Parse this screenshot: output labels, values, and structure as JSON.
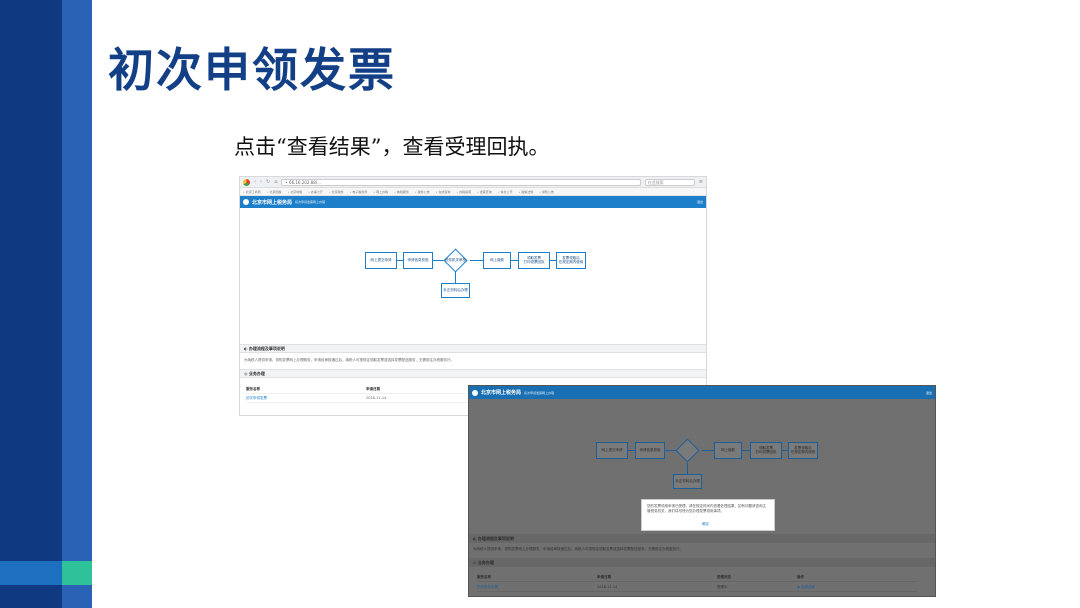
{
  "slide": {
    "title": "初次申领发票",
    "instruction": "点击“查看结果”，查看受理回执。"
  },
  "browser": {
    "url": "• 66.16.202.88/...",
    "search_placeholder": "在此搜索",
    "bookmarks": [
      "• 北京工商局",
      "• 北京国税",
      "• 北京地税",
      "• 办事大厅",
      "• 北京税务",
      "• 电子税务局",
      "• 网上办税",
      "• 纳税服务",
      "• 税务公告",
      "• 在线咨询",
      "• 办税指南",
      "• 发票查询",
      "• 信息公开",
      "• 政策法规",
      "• 通知公告"
    ]
  },
  "site": {
    "name": "北京市网上税务局",
    "subtitle": "初次申领发票网上办理",
    "user": "退出"
  },
  "flow": {
    "step1": "网上提交申请",
    "step2": "申请信息校验",
    "step3": "税务机关审核",
    "step4": "网上缴款",
    "step5": "领取发票\n打印领票回执",
    "step6": "发票领取后\n在规定期内使用",
    "side": "补正材料后办理"
  },
  "sections": {
    "guide_title": "◐ 办理流程及事项说明",
    "guide_text": "为纳税人提供申请、领购发票网上办理服务，申请经审核通过后，纳税人可按规定领取发票或选择发票配送服务，无需前往办税服务厅。",
    "records_title": "◎ 业务办理"
  },
  "table": {
    "headers": [
      "服务名称",
      "申请日期",
      "受理状态"
    ],
    "rows": [
      [
        "初次申领发票",
        "2018-11-14",
        "受理中"
      ]
    ]
  },
  "dialog": {
    "message": "您的发票领用申请已受理，请在规定时间内查看处理结果，如有问题请咨询主管税务机关，我们将尽快为您办理发票领用事项。",
    "button": "确定"
  },
  "overlay": {
    "headers": [
      "服务名称",
      "申请日期",
      "受理状态",
      "操作"
    ],
    "row": [
      "初次申领发票",
      "2018-11-14",
      "受理中",
      "◉ 查看结果"
    ]
  },
  "colors": {
    "brand_dark": "#0f3a82",
    "brand_mid": "#2a62b6",
    "accent": "#2fc29a",
    "site_header": "#1d7fc9"
  }
}
